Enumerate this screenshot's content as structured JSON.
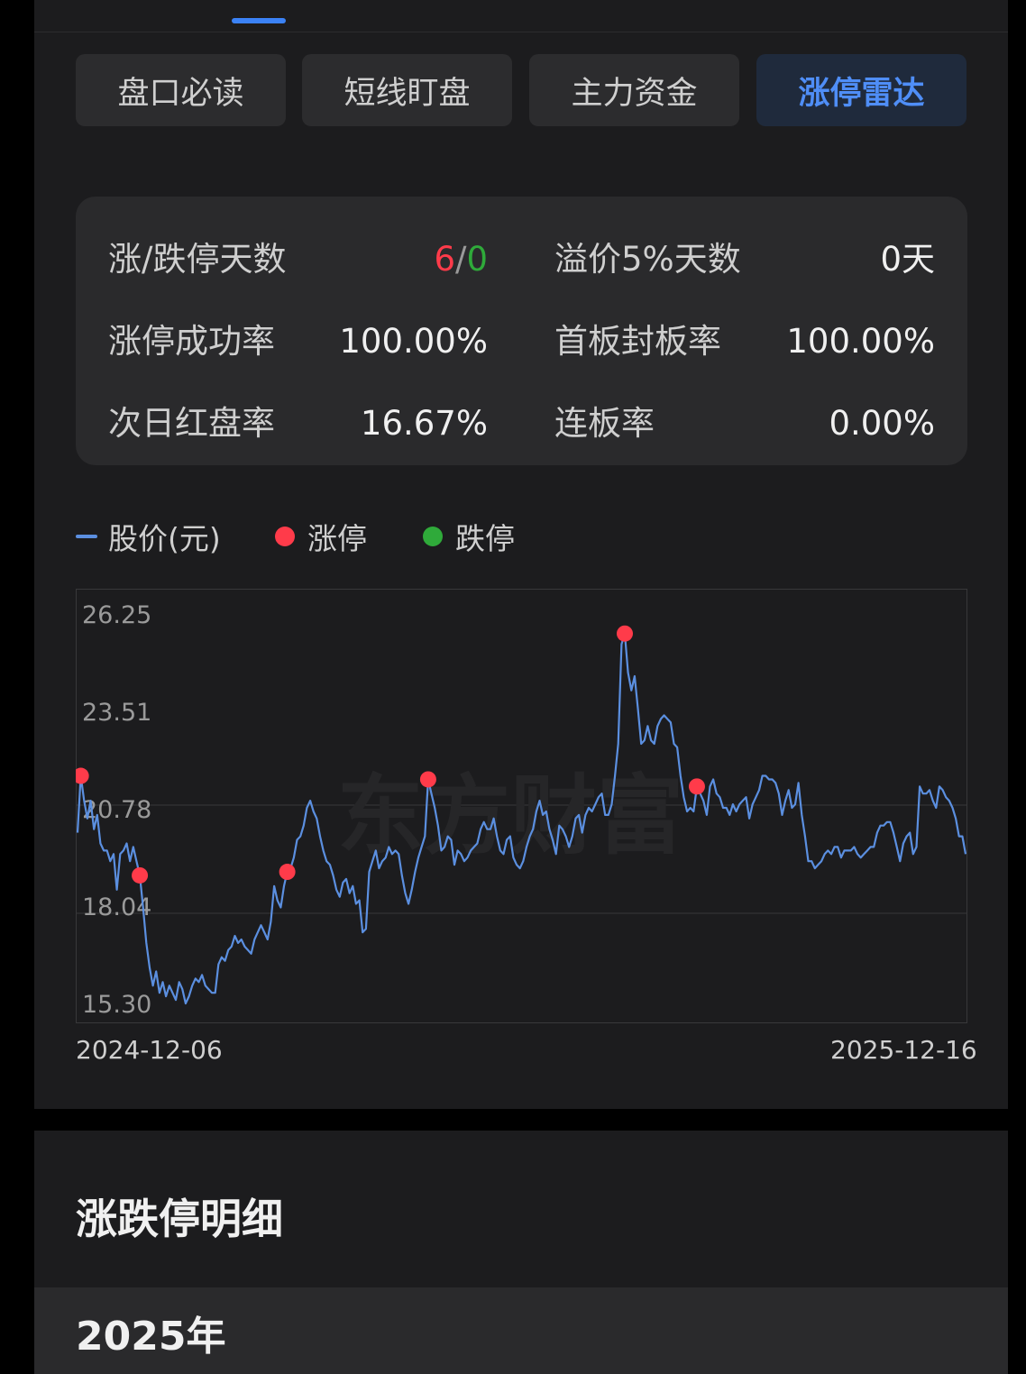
{
  "tabs": [
    {
      "label": "盘口必读",
      "active": false
    },
    {
      "label": "短线盯盘",
      "active": false
    },
    {
      "label": "主力资金",
      "active": false
    },
    {
      "label": "涨停雷达",
      "active": true
    }
  ],
  "stats": {
    "limit_days_label": "涨/跌停天数",
    "limit_up_days": "6",
    "limit_sep": "/",
    "limit_down_days": "0",
    "premium_label": "溢价5%天数",
    "premium_value": "0天",
    "success_label": "涨停成功率",
    "success_value": "100.00%",
    "first_board_label": "首板封板率",
    "first_board_value": "100.00%",
    "next_day_label": "次日红盘率",
    "next_day_value": "16.67%",
    "consecutive_label": "连板率",
    "consecutive_value": "0.00%"
  },
  "legend": {
    "price": "股价(元)",
    "limit_up": "涨停",
    "limit_down": "跌停"
  },
  "colors": {
    "up": "#ff3b4a",
    "down": "#2faa3a",
    "accent": "#4f8ef7",
    "line": "#5b8fe0"
  },
  "chart_data": {
    "type": "line",
    "y_ticks": [
      "26.25",
      "23.51",
      "20.78",
      "18.04",
      "15.30"
    ],
    "ylim": [
      15.3,
      26.25
    ],
    "x_start_label": "2024-12-06",
    "x_end_label": "2025-12-16",
    "watermark": "东方财富",
    "series": [
      {
        "values": [
          20.1,
          21.7,
          21.0,
          20.5,
          21.0,
          20.2,
          20.6,
          19.8,
          19.6,
          19.6,
          19.3,
          19.5,
          18.5,
          19.5,
          19.6,
          19.8,
          19.3,
          19.7,
          19.3,
          18.9,
          18.0,
          17.0,
          16.3,
          15.8,
          16.2,
          15.6,
          15.9,
          15.5,
          15.8,
          15.6,
          15.4,
          15.9,
          15.7,
          15.3,
          15.5,
          15.8,
          16.0,
          15.9,
          16.1,
          15.8,
          15.7,
          15.6,
          15.6,
          16.4,
          16.6,
          16.5,
          16.8,
          16.9,
          17.2,
          17.0,
          17.1,
          16.9,
          16.8,
          16.7,
          17.1,
          17.3,
          17.5,
          17.3,
          17.1,
          17.6,
          18.6,
          18.2,
          18.0,
          18.6,
          19.0,
          19.1,
          19.4,
          19.9,
          20.0,
          20.3,
          20.8,
          21.0,
          20.7,
          20.5,
          20.0,
          19.6,
          19.3,
          19.2,
          18.9,
          18.5,
          18.3,
          18.7,
          18.8,
          18.4,
          18.6,
          18.1,
          18.2,
          17.3,
          17.4,
          19.0,
          19.3,
          19.6,
          19.1,
          19.3,
          19.4,
          19.7,
          19.5,
          19.6,
          19.5,
          18.9,
          18.4,
          18.1,
          18.5,
          19.0,
          19.4,
          19.7,
          20.0,
          21.6,
          21.2,
          20.8,
          20.3,
          19.6,
          19.7,
          20.0,
          19.9,
          19.2,
          19.6,
          19.5,
          19.3,
          19.4,
          19.6,
          19.7,
          19.8,
          20.2,
          20.4,
          20.2,
          20.2,
          20.5,
          20.0,
          19.6,
          19.5,
          19.9,
          20.0,
          19.4,
          19.2,
          19.1,
          19.3,
          19.7,
          20.0,
          20.2,
          20.7,
          21.0,
          20.6,
          20.7,
          20.2,
          19.9,
          19.5,
          20.3,
          20.2,
          20.0,
          19.7,
          20.0,
          20.5,
          20.6,
          20.1,
          20.6,
          20.8,
          20.7,
          20.9,
          21.1,
          21.2,
          20.6,
          20.6,
          20.9,
          21.7,
          22.6,
          25.4,
          25.7,
          24.6,
          24.1,
          24.5,
          23.6,
          22.6,
          22.7,
          23.1,
          22.7,
          22.6,
          23.1,
          23.3,
          23.4,
          23.3,
          23.2,
          22.6,
          22.5,
          21.7,
          21.1,
          20.7,
          20.8,
          20.7,
          21.4,
          21.2,
          21.0,
          20.6,
          21.4,
          21.6,
          21.2,
          21.1,
          20.8,
          20.8,
          20.6,
          20.9,
          20.7,
          20.9,
          21.0,
          21.1,
          20.5,
          20.9,
          21.1,
          21.3,
          21.7,
          21.7,
          21.6,
          21.6,
          21.5,
          21.2,
          20.6,
          21.0,
          21.3,
          20.8,
          20.9,
          21.5,
          20.6,
          20.0,
          19.3,
          19.3,
          19.1,
          19.2,
          19.3,
          19.5,
          19.6,
          19.5,
          19.7,
          19.7,
          19.4,
          19.6,
          19.6,
          19.6,
          19.7,
          19.5,
          19.4,
          19.5,
          19.6,
          19.7,
          19.7,
          20.1,
          20.3,
          20.3,
          20.4,
          20.4,
          20.1,
          19.7,
          19.3,
          19.8,
          20.0,
          20.1,
          19.5,
          19.7,
          21.4,
          21.2,
          21.2,
          21.3,
          21.0,
          20.8,
          21.4,
          21.3,
          21.1,
          21.0,
          20.8,
          20.5,
          20.0,
          20.0,
          19.5
        ],
        "limit_up_values": [
          21.7,
          18.9,
          19.0,
          21.6,
          25.7,
          21.4
        ]
      }
    ]
  },
  "detail": {
    "title": "涨跌停明细",
    "year": "2025年"
  }
}
